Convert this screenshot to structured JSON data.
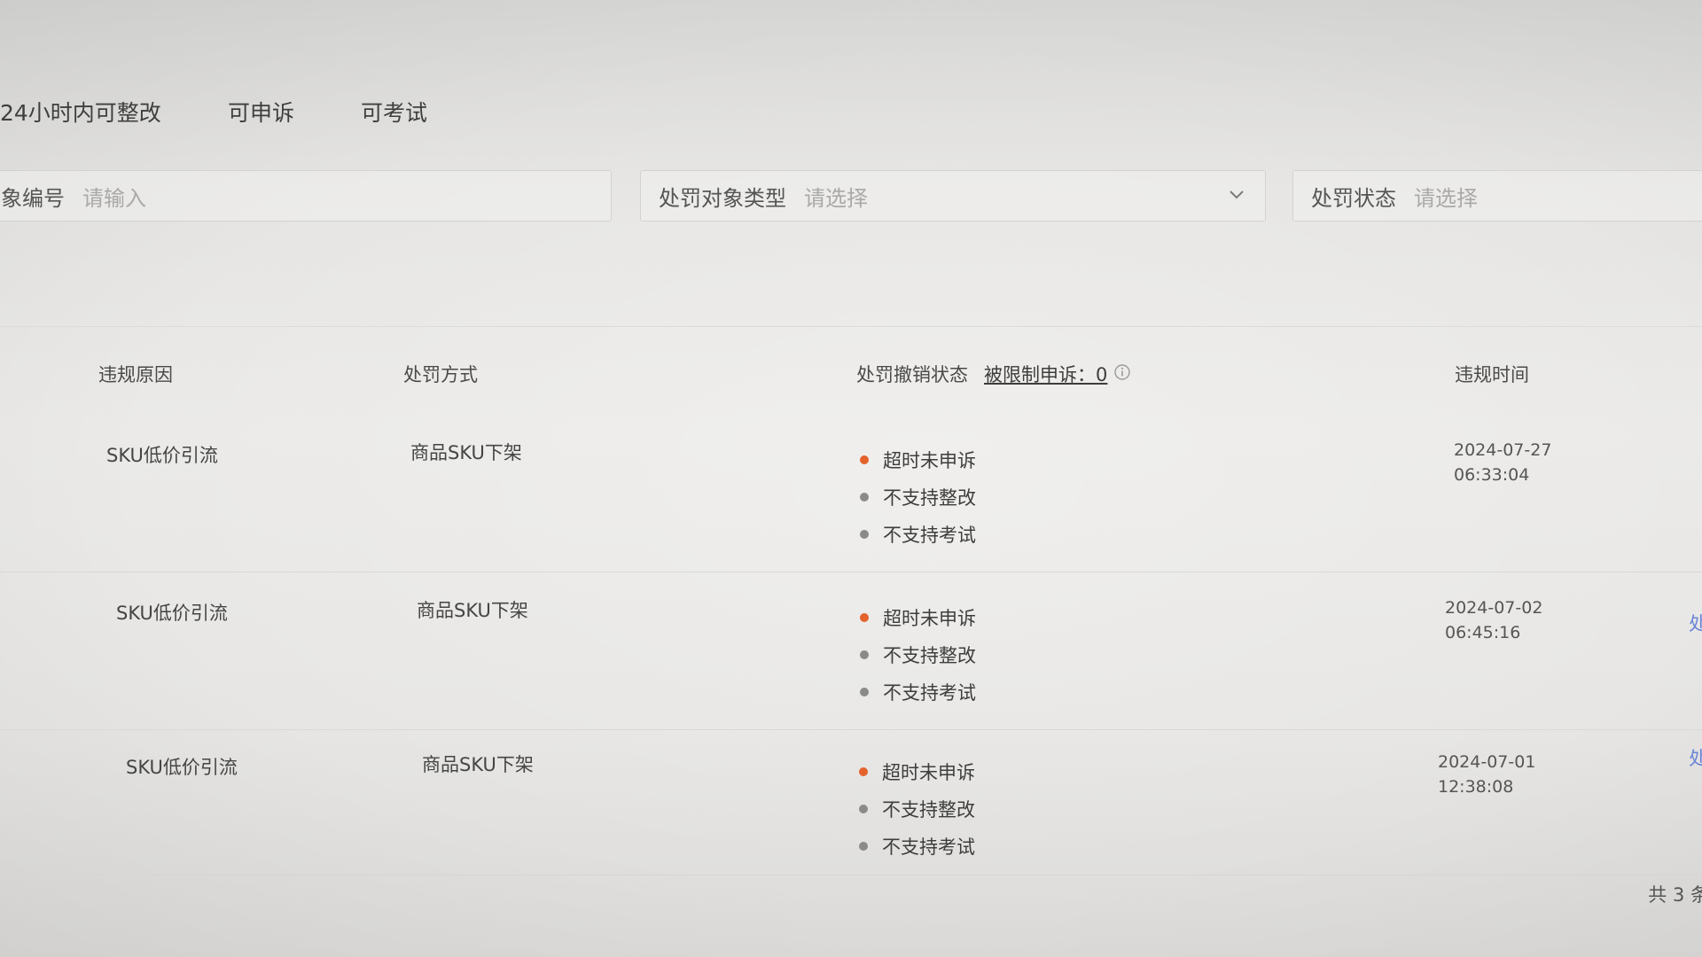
{
  "tabs": [
    {
      "label": "24小时内可整改"
    },
    {
      "label": "可申诉"
    },
    {
      "label": "可考试"
    }
  ],
  "filters": {
    "object_id": {
      "label": "象编号",
      "placeholder": "请输入"
    },
    "object_type": {
      "label": "处罚对象类型",
      "placeholder": "请选择"
    },
    "status": {
      "label": "处罚状态",
      "placeholder": "请选择"
    }
  },
  "table": {
    "headers": {
      "reason": "违规原因",
      "method": "处罚方式",
      "revoke_status": "处罚撤销状态",
      "restricted_link": "被限制申诉：0",
      "time": "违规时间"
    },
    "rows": [
      {
        "reason": "SKU低价引流",
        "method": "商品SKU下架",
        "statuses": [
          "超时未申诉",
          "不支持整改",
          "不支持考试"
        ],
        "date": "2024-07-27",
        "clock": "06:33:04",
        "action": ""
      },
      {
        "reason": "SKU低价引流",
        "method": "商品SKU下架",
        "statuses": [
          "超时未申诉",
          "不支持整改",
          "不支持考试"
        ],
        "date": "2024-07-02",
        "clock": "06:45:16",
        "action": "处"
      },
      {
        "reason": "SKU低价引流",
        "method": "商品SKU下架",
        "statuses": [
          "超时未申诉",
          "不支持整改",
          "不支持考试"
        ],
        "date": "2024-07-01",
        "clock": "12:38:08",
        "action": "处"
      }
    ]
  },
  "pagination": {
    "total_text": "共 3 条"
  },
  "colors": {
    "status_warn": "#e4622c",
    "status_neutral": "#8a8a8a",
    "link": "#6a84d8"
  }
}
